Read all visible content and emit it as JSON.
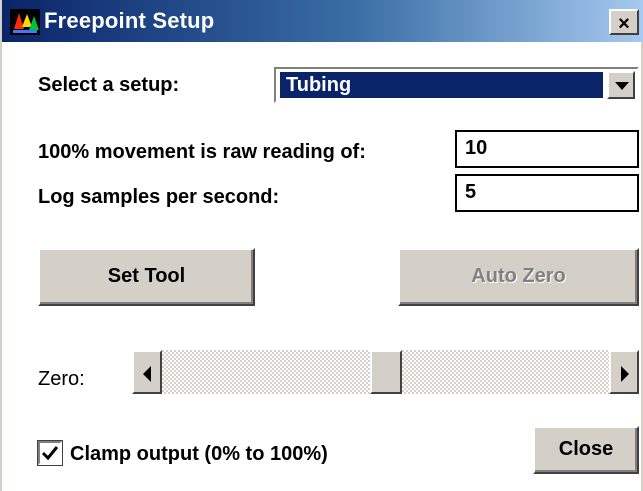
{
  "window": {
    "title": "Freepoint Setup",
    "close_glyph": "×"
  },
  "setup": {
    "label": "Select a setup:",
    "selected": "Tubing"
  },
  "movement": {
    "label": "100% movement is raw reading of:",
    "value": "10"
  },
  "samples": {
    "label": "Log samples per second:",
    "value": "5"
  },
  "buttons": {
    "set_tool": "Set Tool",
    "auto_zero": "Auto Zero",
    "close": "Close"
  },
  "zero": {
    "label": "Zero:",
    "slider_fraction": 0.5
  },
  "clamp": {
    "label": "Clamp output (0% to 100%)",
    "checked": true
  },
  "colors": {
    "title_start": "#0a246a",
    "title_end": "#a6caf0",
    "face": "#d4d0c8",
    "selection": "#0a246a"
  },
  "icons": {
    "app": "freepoint-app-icon",
    "close": "close-icon",
    "dropdown": "chevron-down-icon",
    "check": "checkmark-icon"
  }
}
